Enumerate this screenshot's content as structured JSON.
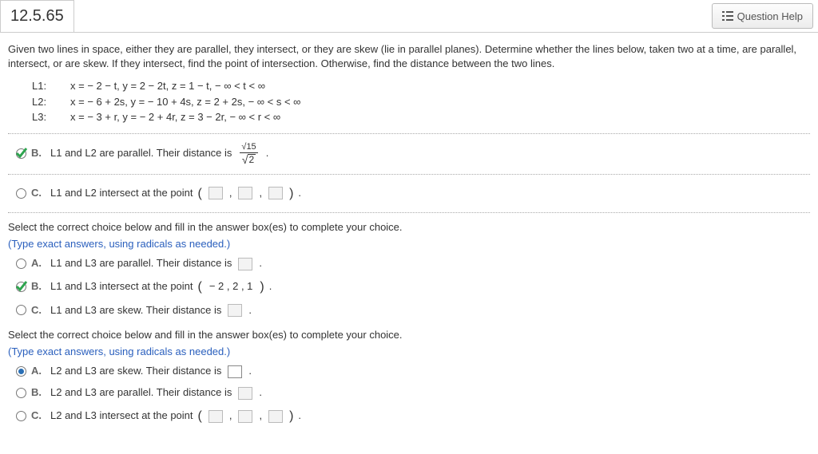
{
  "header": {
    "question_number": "12.5.65",
    "help_label": "Question Help"
  },
  "instructions": "Given two lines in space, either they are parallel, they intersect, or they are skew (lie in parallel planes). Determine whether the lines below, taken two at a time, are parallel, intersect, or are skew. If they intersect, find the point of intersection. Otherwise, find the distance between the two lines.",
  "lines": {
    "L1": {
      "label": "L1:",
      "eq": "x = − 2 − t, y = 2 − 2t, z = 1 − t,  − ∞ < t < ∞"
    },
    "L2": {
      "label": "L2:",
      "eq": "x = − 6 + 2s, y = − 10 + 4s, z = 2 + 2s,  − ∞ < s < ∞"
    },
    "L3": {
      "label": "L3:",
      "eq": "x = − 3 + r, y = − 2 + 4r, z = 3 − 2r,  − ∞ < r < ∞"
    }
  },
  "group1": {
    "B": {
      "letter": "B.",
      "text_before": "L1 and L2 are parallel. Their distance is",
      "frac_num": "√15",
      "frac_den_sqrt_arg": "2",
      "after": "."
    },
    "C": {
      "letter": "C.",
      "text_before": "L1 and L2 intersect at the point",
      "after": "."
    }
  },
  "section_instruction": "Select the correct choice below and fill in the answer box(es) to complete your choice.",
  "hint": "(Type exact answers, using radicals as needed.)",
  "group2": {
    "A": {
      "letter": "A.",
      "text": "L1 and L3 are parallel. Their distance is",
      "after": "."
    },
    "B": {
      "letter": "B.",
      "text_before": "L1 and L3 intersect at the point",
      "coords": "− 2 , 2 , 1",
      "after": "."
    },
    "C": {
      "letter": "C.",
      "text": "L1 and L3 are skew. Their distance is",
      "after": "."
    }
  },
  "group3": {
    "A": {
      "letter": "A.",
      "text": "L2 and L3 are skew. Their distance is",
      "after": "."
    },
    "B": {
      "letter": "B.",
      "text": "L2 and L3 are parallel. Their distance is",
      "after": "."
    },
    "C": {
      "letter": "C.",
      "text_before": "L2 and L3 intersect at the point",
      "after": "."
    }
  }
}
